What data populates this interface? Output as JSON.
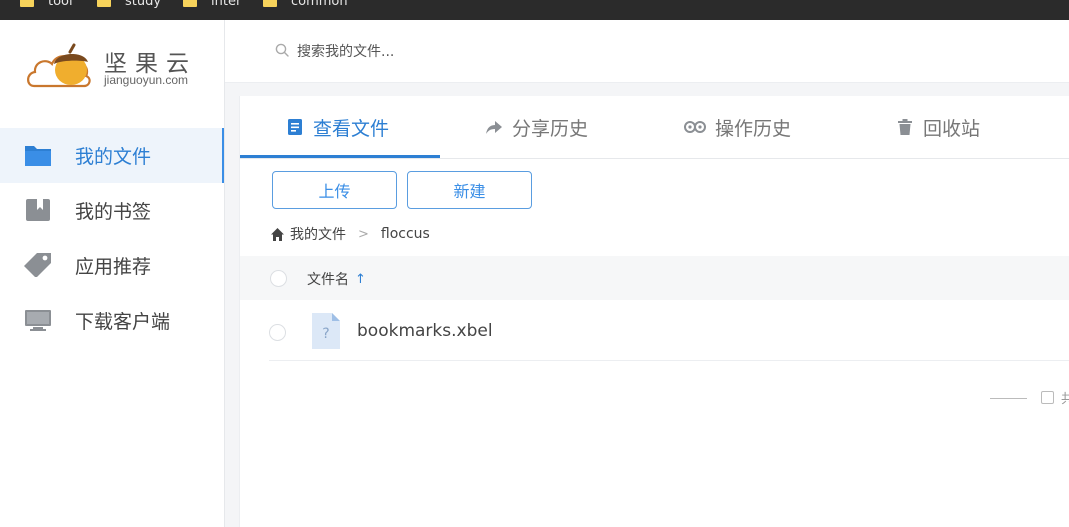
{
  "bookmarks_bar": {
    "items": [
      "tool",
      "study",
      "inter",
      "common"
    ]
  },
  "sidebar": {
    "logo": {
      "name": "坚果云",
      "domain": "jianguoyun.com"
    },
    "items": [
      {
        "label": "我的文件",
        "icon": "folder-icon",
        "active": true
      },
      {
        "label": "我的书签",
        "icon": "bookmark-icon",
        "active": false
      },
      {
        "label": "应用推荐",
        "icon": "tag-icon",
        "active": false
      },
      {
        "label": "下载客户端",
        "icon": "monitor-icon",
        "active": false
      }
    ]
  },
  "search": {
    "placeholder": "搜索我的文件..."
  },
  "tabs": [
    {
      "label": "查看文件",
      "icon": "document-icon",
      "active": true
    },
    {
      "label": "分享历史",
      "icon": "share-icon",
      "active": false
    },
    {
      "label": "操作历史",
      "icon": "history-icon",
      "active": false
    },
    {
      "label": "回收站",
      "icon": "trash-icon",
      "active": false
    }
  ],
  "toolbar": {
    "upload_label": "上传",
    "new_label": "新建"
  },
  "breadcrumb": {
    "root": "我的文件",
    "separator": ">",
    "current": "floccus"
  },
  "table": {
    "column_name": "文件名",
    "sort": "ascending",
    "rows": [
      {
        "name": "bookmarks.xbel",
        "icon": "unknown-file-icon"
      }
    ]
  },
  "footer": {
    "text": "共"
  },
  "colors": {
    "accent": "#2d7fd3",
    "bookmarks_bar": "#2b2b2b"
  }
}
